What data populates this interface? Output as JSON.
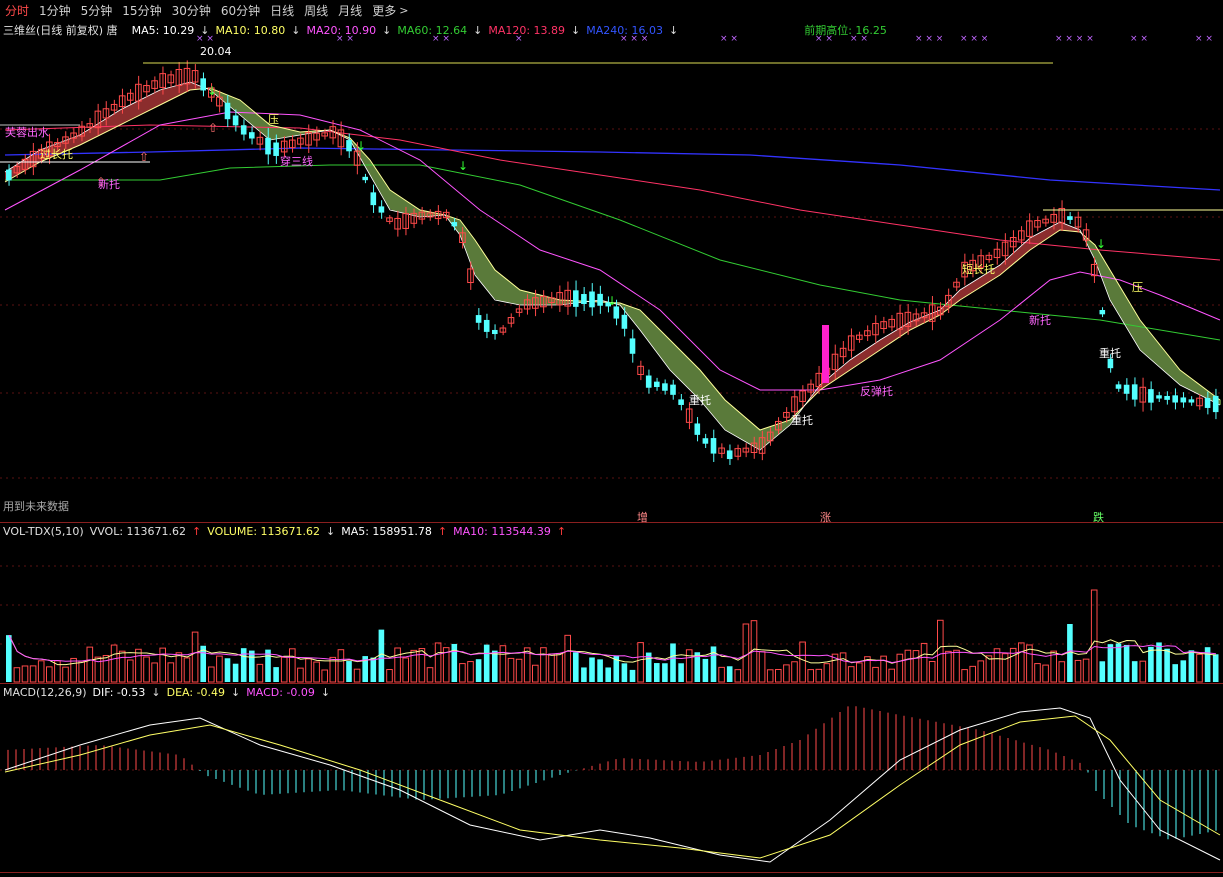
{
  "tabs": [
    {
      "label": "分时",
      "active": true
    },
    {
      "label": "1分钟",
      "active": false
    },
    {
      "label": "5分钟",
      "active": false
    },
    {
      "label": "15分钟",
      "active": false
    },
    {
      "label": "30分钟",
      "active": false
    },
    {
      "label": "60分钟",
      "active": false
    },
    {
      "label": "日线",
      "active": false
    },
    {
      "label": "周线",
      "active": false
    },
    {
      "label": "月线",
      "active": false
    },
    {
      "label": "更多",
      "active": false
    }
  ],
  "more_icon": "chevron-right-icon",
  "main_header": {
    "title": "三维丝(日线 前复权) 唐",
    "ma5": "MA5: 10.29",
    "ma10": "MA10: 10.80",
    "ma20": "MA20: 10.90",
    "ma60": "MA60: 12.64",
    "ma120": "MA120: 13.89",
    "ma240": "MA240: 16.03",
    "prior_high": "前期高位: 16.25"
  },
  "price_labels": {
    "peak": "20.04",
    "fm_left": "芙蓉出水",
    "left_longtuo": "过长托",
    "new_tuo1": "新托",
    "cross3": "穿三线",
    "ya1": "压",
    "ya2": "压",
    "zhongtuo1": "重托",
    "zhongtuo2": "重托",
    "zhongtuo3": "重托",
    "rebound_tuo": "反弹托",
    "short_tuo": "短长托",
    "new_tuo2": "新托",
    "future_note": "用到未来数据",
    "zeng": "增",
    "zhang": "涨",
    "die": "跌"
  },
  "vol_header": {
    "title": "VOL-TDX(5,10)",
    "vvol": "VVOL: 113671.62",
    "volume": "VOLUME: 113671.62",
    "ma5": "MA5: 158951.78",
    "ma10": "MA10: 113544.39"
  },
  "macd_header": {
    "title": "MACD(12,26,9)",
    "dif": "DIF: -0.53",
    "dea": "DEA: -0.49",
    "macd": "MACD: -0.09"
  },
  "colors": {
    "up": "#ff4a4a",
    "down": "#54ffff",
    "ma5": "#ffffff",
    "ma10": "#ffff66",
    "ma20": "#ff55ff",
    "ma60": "#33cc33",
    "ma120": "#ff3366",
    "ma240": "#3333ff",
    "frame": "#8a1f1f",
    "grid": "#6b1515"
  }
}
